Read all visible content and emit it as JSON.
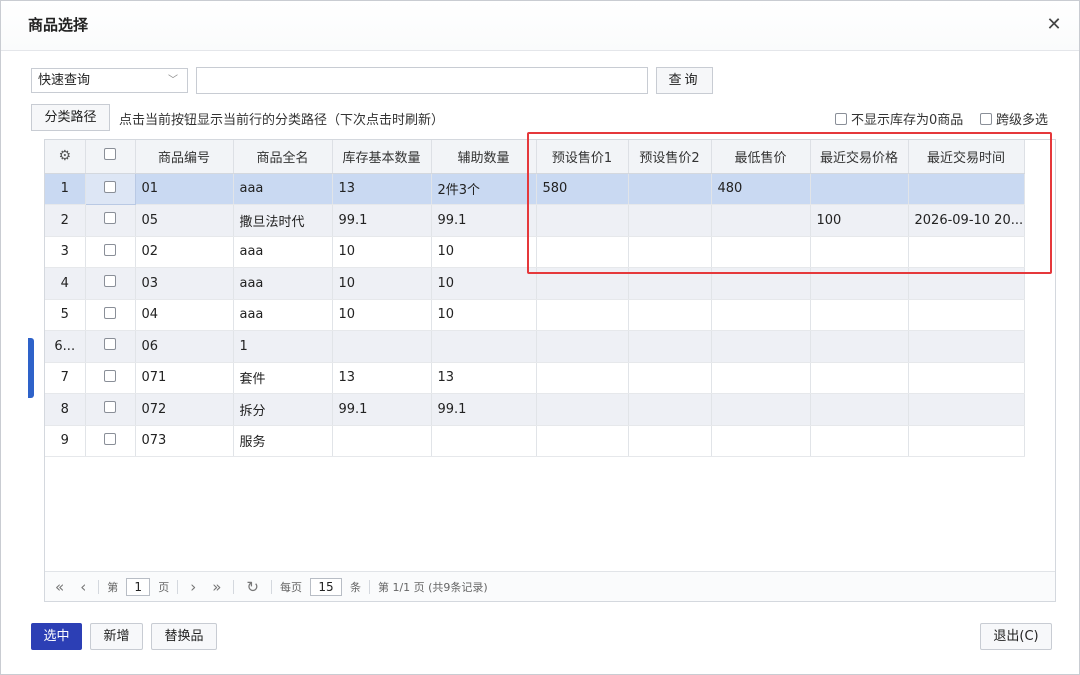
{
  "dialog": {
    "title": "商品选择",
    "close_glyph": "✕"
  },
  "toolbar": {
    "query_type": "快速查询",
    "search_value": "",
    "search_placeholder": "",
    "query_button": "查询",
    "path_button": "分类路径",
    "path_hint": "点击当前按钮显示当前行的分类路径（下次点击时刷新）",
    "opt_hide_zero": "不显示库存为0商品",
    "opt_cross_multi": "跨级多选"
  },
  "grid": {
    "columns": [
      "商品编号",
      "商品全名",
      "库存基本数量",
      "辅助数量",
      "预设售价1",
      "预设售价2",
      "最低售价",
      "最近交易价格",
      "最近交易时间"
    ],
    "rows": [
      {
        "idx": "1",
        "code": "01",
        "name": "aaa",
        "qty": "13",
        "aux": "2件3个",
        "p1": "580",
        "p2": "",
        "min": "480",
        "last_price": "",
        "last_time": ""
      },
      {
        "idx": "2",
        "code": "05",
        "name": "撒旦法时代",
        "qty": "99.1",
        "aux": "99.1",
        "p1": "",
        "p2": "",
        "min": "",
        "last_price": "100",
        "last_time": "2026-09-10 20..."
      },
      {
        "idx": "3",
        "code": "02",
        "name": "aaa",
        "qty": "10",
        "aux": "10",
        "p1": "",
        "p2": "",
        "min": "",
        "last_price": "",
        "last_time": ""
      },
      {
        "idx": "4",
        "code": "03",
        "name": "aaa",
        "qty": "10",
        "aux": "10",
        "p1": "",
        "p2": "",
        "min": "",
        "last_price": "",
        "last_time": ""
      },
      {
        "idx": "5",
        "code": "04",
        "name": "aaa",
        "qty": "10",
        "aux": "10",
        "p1": "",
        "p2": "",
        "min": "",
        "last_price": "",
        "last_time": ""
      },
      {
        "idx": "6...",
        "code": "06",
        "name": "1",
        "qty": "",
        "aux": "",
        "p1": "",
        "p2": "",
        "min": "",
        "last_price": "",
        "last_time": ""
      },
      {
        "idx": "7",
        "code": "071",
        "name": "套件",
        "qty": "13",
        "aux": "13",
        "p1": "",
        "p2": "",
        "min": "",
        "last_price": "",
        "last_time": ""
      },
      {
        "idx": "8",
        "code": "072",
        "name": "拆分",
        "qty": "99.1",
        "aux": "99.1",
        "p1": "",
        "p2": "",
        "min": "",
        "last_price": "",
        "last_time": ""
      },
      {
        "idx": "9",
        "code": "073",
        "name": "服务",
        "qty": "",
        "aux": "",
        "p1": "",
        "p2": "",
        "min": "",
        "last_price": "",
        "last_time": ""
      }
    ]
  },
  "pager": {
    "first": "«",
    "prev": "‹",
    "next": "›",
    "last": "»",
    "refresh": "↻",
    "page_prefix": "第",
    "page_value": "1",
    "page_suffix": "页",
    "per_prefix": "每页",
    "per_value": "15",
    "per_suffix": "条",
    "summary": "第 1/1 页 (共9条记录)"
  },
  "footer": {
    "select": "选中",
    "add": "新增",
    "replace": "替换品",
    "exit": "退出(C)"
  },
  "colors": {
    "primary": "#2c3fb5",
    "selected_row": "#c9d9f2",
    "highlight": "#e5383b"
  }
}
